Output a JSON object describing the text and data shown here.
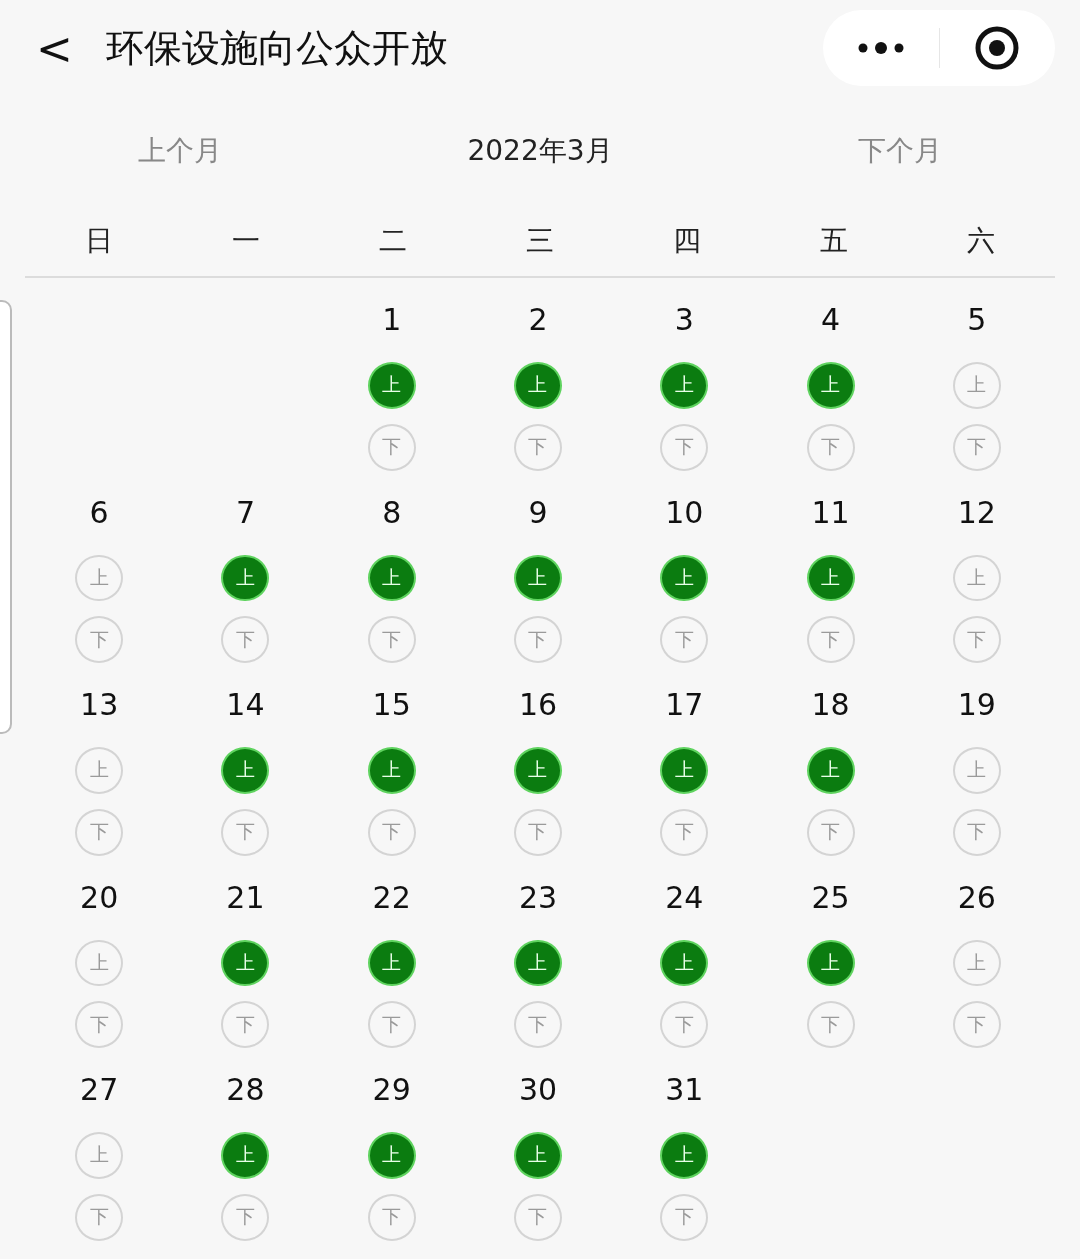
{
  "header": {
    "back": "<",
    "title": "环保设施向公众开放"
  },
  "month_nav": {
    "prev": "上个月",
    "current": "2022年3月",
    "next": "下个月"
  },
  "weekdays": [
    "日",
    "一",
    "二",
    "三",
    "四",
    "五",
    "六"
  ],
  "weeks": [
    [
      {
        "kind": "blank"
      },
      {
        "kind": "blank"
      },
      {
        "kind": "day",
        "day": "1",
        "am": {
          "label": "上",
          "on": true
        },
        "pm": {
          "label": "下",
          "on": false
        }
      },
      {
        "kind": "day",
        "day": "2",
        "am": {
          "label": "上",
          "on": true
        },
        "pm": {
          "label": "下",
          "on": false
        }
      },
      {
        "kind": "day",
        "day": "3",
        "am": {
          "label": "上",
          "on": true
        },
        "pm": {
          "label": "下",
          "on": false
        }
      },
      {
        "kind": "day",
        "day": "4",
        "am": {
          "label": "上",
          "on": true
        },
        "pm": {
          "label": "下",
          "on": false
        }
      },
      {
        "kind": "day",
        "day": "5",
        "am": {
          "label": "上",
          "on": false
        },
        "pm": {
          "label": "下",
          "on": false
        }
      }
    ],
    [
      {
        "kind": "day",
        "day": "6",
        "am": {
          "label": "上",
          "on": false
        },
        "pm": {
          "label": "下",
          "on": false
        }
      },
      {
        "kind": "day",
        "day": "7",
        "am": {
          "label": "上",
          "on": true
        },
        "pm": {
          "label": "下",
          "on": false
        }
      },
      {
        "kind": "day",
        "day": "8",
        "am": {
          "label": "上",
          "on": true
        },
        "pm": {
          "label": "下",
          "on": false
        }
      },
      {
        "kind": "day",
        "day": "9",
        "am": {
          "label": "上",
          "on": true
        },
        "pm": {
          "label": "下",
          "on": false
        }
      },
      {
        "kind": "day",
        "day": "10",
        "am": {
          "label": "上",
          "on": true
        },
        "pm": {
          "label": "下",
          "on": false
        }
      },
      {
        "kind": "day",
        "day": "11",
        "am": {
          "label": "上",
          "on": true
        },
        "pm": {
          "label": "下",
          "on": false
        }
      },
      {
        "kind": "day",
        "day": "12",
        "am": {
          "label": "上",
          "on": false
        },
        "pm": {
          "label": "下",
          "on": false
        }
      }
    ],
    [
      {
        "kind": "day",
        "day": "13",
        "am": {
          "label": "上",
          "on": false
        },
        "pm": {
          "label": "下",
          "on": false
        }
      },
      {
        "kind": "day",
        "day": "14",
        "am": {
          "label": "上",
          "on": true
        },
        "pm": {
          "label": "下",
          "on": false
        }
      },
      {
        "kind": "day",
        "day": "15",
        "am": {
          "label": "上",
          "on": true
        },
        "pm": {
          "label": "下",
          "on": false
        }
      },
      {
        "kind": "day",
        "day": "16",
        "am": {
          "label": "上",
          "on": true
        },
        "pm": {
          "label": "下",
          "on": false
        }
      },
      {
        "kind": "day",
        "day": "17",
        "am": {
          "label": "上",
          "on": true
        },
        "pm": {
          "label": "下",
          "on": false
        }
      },
      {
        "kind": "day",
        "day": "18",
        "am": {
          "label": "上",
          "on": true
        },
        "pm": {
          "label": "下",
          "on": false
        }
      },
      {
        "kind": "day",
        "day": "19",
        "am": {
          "label": "上",
          "on": false
        },
        "pm": {
          "label": "下",
          "on": false
        }
      }
    ],
    [
      {
        "kind": "day",
        "day": "20",
        "am": {
          "label": "上",
          "on": false
        },
        "pm": {
          "label": "下",
          "on": false
        }
      },
      {
        "kind": "day",
        "day": "21",
        "am": {
          "label": "上",
          "on": true
        },
        "pm": {
          "label": "下",
          "on": false
        }
      },
      {
        "kind": "day",
        "day": "22",
        "am": {
          "label": "上",
          "on": true
        },
        "pm": {
          "label": "下",
          "on": false
        }
      },
      {
        "kind": "day",
        "day": "23",
        "am": {
          "label": "上",
          "on": true
        },
        "pm": {
          "label": "下",
          "on": false
        }
      },
      {
        "kind": "day",
        "day": "24",
        "am": {
          "label": "上",
          "on": true
        },
        "pm": {
          "label": "下",
          "on": false
        }
      },
      {
        "kind": "day",
        "day": "25",
        "am": {
          "label": "上",
          "on": true
        },
        "pm": {
          "label": "下",
          "on": false
        }
      },
      {
        "kind": "day",
        "day": "26",
        "am": {
          "label": "上",
          "on": false
        },
        "pm": {
          "label": "下",
          "on": false
        }
      }
    ],
    [
      {
        "kind": "day",
        "day": "27",
        "am": {
          "label": "上",
          "on": false
        },
        "pm": {
          "label": "下",
          "on": false
        }
      },
      {
        "kind": "day",
        "day": "28",
        "am": {
          "label": "上",
          "on": true
        },
        "pm": {
          "label": "下",
          "on": false
        }
      },
      {
        "kind": "day",
        "day": "29",
        "am": {
          "label": "上",
          "on": true
        },
        "pm": {
          "label": "下",
          "on": false
        }
      },
      {
        "kind": "day",
        "day": "30",
        "am": {
          "label": "上",
          "on": true
        },
        "pm": {
          "label": "下",
          "on": false
        }
      },
      {
        "kind": "day",
        "day": "31",
        "am": {
          "label": "上",
          "on": true
        },
        "pm": {
          "label": "下",
          "on": false
        }
      }
    ]
  ]
}
